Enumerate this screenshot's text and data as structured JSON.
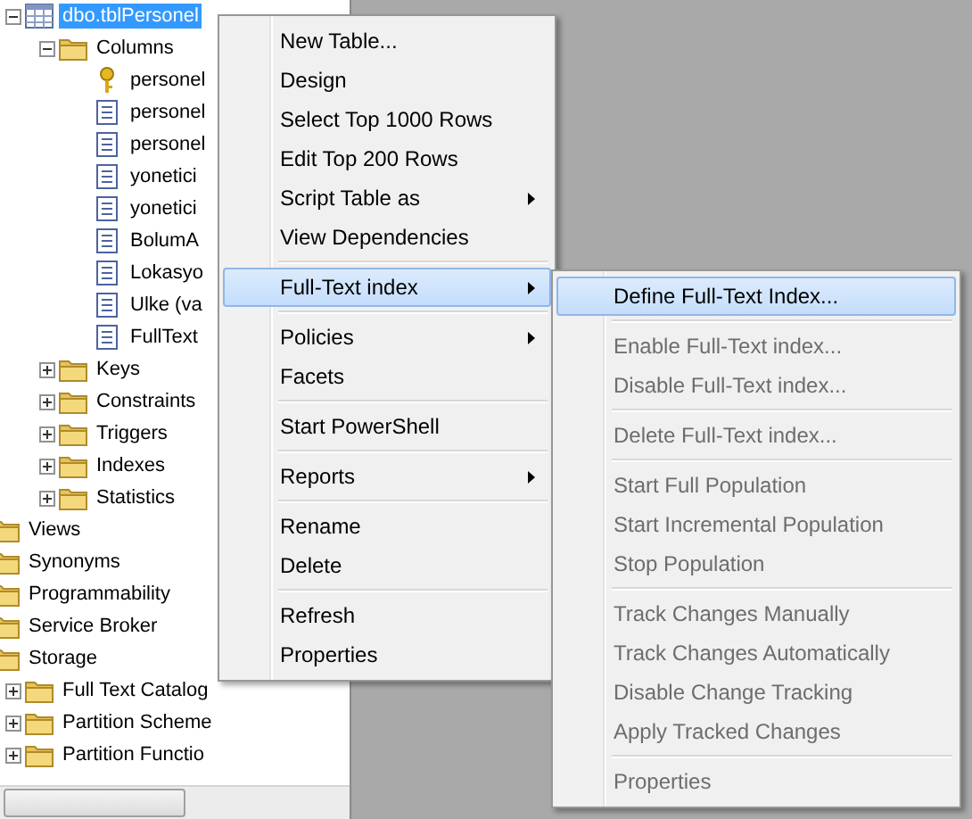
{
  "table_node": {
    "label": "dbo.tblPersonel",
    "kind": "table",
    "expanded": true,
    "selected": true,
    "children": [
      {
        "label": "Columns",
        "kind": "folder",
        "expanded": true,
        "selected": false,
        "children": [
          {
            "label": "personel",
            "kind": "key",
            "selected": false
          },
          {
            "label": "personel",
            "kind": "column",
            "selected": false
          },
          {
            "label": "personel",
            "kind": "column",
            "selected": false
          },
          {
            "label": "yonetici",
            "kind": "column",
            "selected": false
          },
          {
            "label": "yonetici",
            "kind": "column",
            "selected": false
          },
          {
            "label": "BolumA",
            "kind": "column",
            "selected": false
          },
          {
            "label": "Lokasyo",
            "kind": "column",
            "selected": false
          },
          {
            "label": "Ulke (va",
            "kind": "column",
            "selected": false
          },
          {
            "label": "FullText",
            "kind": "column",
            "selected": false
          }
        ]
      },
      {
        "label": "Keys",
        "kind": "folder",
        "expanded": false,
        "selected": false
      },
      {
        "label": "Constraints",
        "kind": "folder",
        "expanded": false,
        "selected": false
      },
      {
        "label": "Triggers",
        "kind": "folder",
        "expanded": false,
        "selected": false
      },
      {
        "label": "Indexes",
        "kind": "folder",
        "expanded": false,
        "selected": false
      },
      {
        "label": "Statistics",
        "kind": "folder",
        "expanded": false,
        "selected": false
      }
    ]
  },
  "database_nodes": [
    {
      "label": "Views",
      "kind": "folder",
      "selected": false
    },
    {
      "label": "Synonyms",
      "kind": "folder",
      "selected": false
    },
    {
      "label": "Programmability",
      "kind": "folder",
      "selected": false
    },
    {
      "label": "Service Broker",
      "kind": "folder",
      "selected": false
    },
    {
      "label": "Storage",
      "kind": "folder",
      "selected": false,
      "children": [
        {
          "label": "Full Text Catalog",
          "kind": "folder",
          "expanded": false,
          "selected": false
        },
        {
          "label": "Partition Scheme",
          "kind": "folder",
          "expanded": false,
          "selected": false
        },
        {
          "label": "Partition Functio",
          "kind": "folder",
          "expanded": false,
          "selected": false
        }
      ]
    }
  ],
  "context_menu": [
    {
      "kind": "item",
      "label": "New Table...",
      "submenu": false,
      "selected": false
    },
    {
      "kind": "item",
      "label": "Design",
      "submenu": false,
      "selected": false
    },
    {
      "kind": "item",
      "label": "Select Top 1000 Rows",
      "submenu": false,
      "selected": false
    },
    {
      "kind": "item",
      "label": "Edit Top 200 Rows",
      "submenu": false,
      "selected": false
    },
    {
      "kind": "item",
      "label": "Script Table as",
      "submenu": true,
      "selected": false
    },
    {
      "kind": "item",
      "label": "View Dependencies",
      "submenu": false,
      "selected": false
    },
    {
      "kind": "separator"
    },
    {
      "kind": "item",
      "label": "Full-Text index",
      "submenu": true,
      "selected": true
    },
    {
      "kind": "separator"
    },
    {
      "kind": "item",
      "label": "Policies",
      "submenu": true,
      "selected": false
    },
    {
      "kind": "item",
      "label": "Facets",
      "submenu": false,
      "selected": false
    },
    {
      "kind": "separator"
    },
    {
      "kind": "item",
      "label": "Start PowerShell",
      "submenu": false,
      "selected": false
    },
    {
      "kind": "separator"
    },
    {
      "kind": "item",
      "label": "Reports",
      "submenu": true,
      "selected": false
    },
    {
      "kind": "separator"
    },
    {
      "kind": "item",
      "label": "Rename",
      "submenu": false,
      "selected": false
    },
    {
      "kind": "item",
      "label": "Delete",
      "submenu": false,
      "selected": false
    },
    {
      "kind": "separator"
    },
    {
      "kind": "item",
      "label": "Refresh",
      "submenu": false,
      "selected": false
    },
    {
      "kind": "item",
      "label": "Properties",
      "submenu": false,
      "selected": false
    }
  ],
  "submenu": [
    {
      "kind": "item",
      "label": "Define Full-Text Index...",
      "disabled": false,
      "selected": true
    },
    {
      "kind": "separator"
    },
    {
      "kind": "item",
      "label": "Enable Full-Text index...",
      "disabled": true,
      "selected": false
    },
    {
      "kind": "item",
      "label": "Disable Full-Text index...",
      "disabled": true,
      "selected": false
    },
    {
      "kind": "separator"
    },
    {
      "kind": "item",
      "label": "Delete Full-Text index...",
      "disabled": true,
      "selected": false
    },
    {
      "kind": "separator"
    },
    {
      "kind": "item",
      "label": "Start Full Population",
      "disabled": true,
      "selected": false
    },
    {
      "kind": "item",
      "label": "Start Incremental Population",
      "disabled": true,
      "selected": false
    },
    {
      "kind": "item",
      "label": "Stop Population",
      "disabled": true,
      "selected": false
    },
    {
      "kind": "separator"
    },
    {
      "kind": "item",
      "label": "Track Changes Manually",
      "disabled": true,
      "selected": false
    },
    {
      "kind": "item",
      "label": "Track Changes Automatically",
      "disabled": true,
      "selected": false
    },
    {
      "kind": "item",
      "label": "Disable Change Tracking",
      "disabled": true,
      "selected": false
    },
    {
      "kind": "item",
      "label": "Apply Tracked Changes",
      "disabled": true,
      "selected": false
    },
    {
      "kind": "separator"
    },
    {
      "kind": "item",
      "label": "Properties",
      "disabled": true,
      "selected": false
    }
  ]
}
